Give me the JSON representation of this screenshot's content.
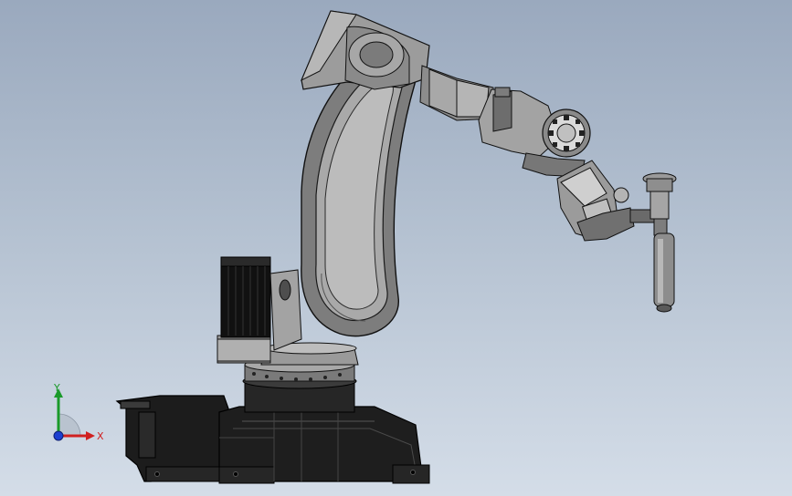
{
  "viewport": {
    "background_top": "#9aa9be",
    "background_bottom": "#d4dde8"
  },
  "model": {
    "parts": [
      "base",
      "turntable",
      "motor",
      "lower-arm",
      "upper-arm-housing",
      "forearm",
      "wrist",
      "tool-flange",
      "torch"
    ],
    "colors": {
      "base": "#1b1b1b",
      "metal_light": "#c9c9c9",
      "metal_mid": "#8f8f8f",
      "metal_dark": "#4a4a4a",
      "outline": "#111111"
    }
  },
  "triad": {
    "x_label": "X",
    "y_label": "Y",
    "x_color": "#d02020",
    "y_color": "#1a9a2a",
    "z_color": "#1c3fd0"
  }
}
